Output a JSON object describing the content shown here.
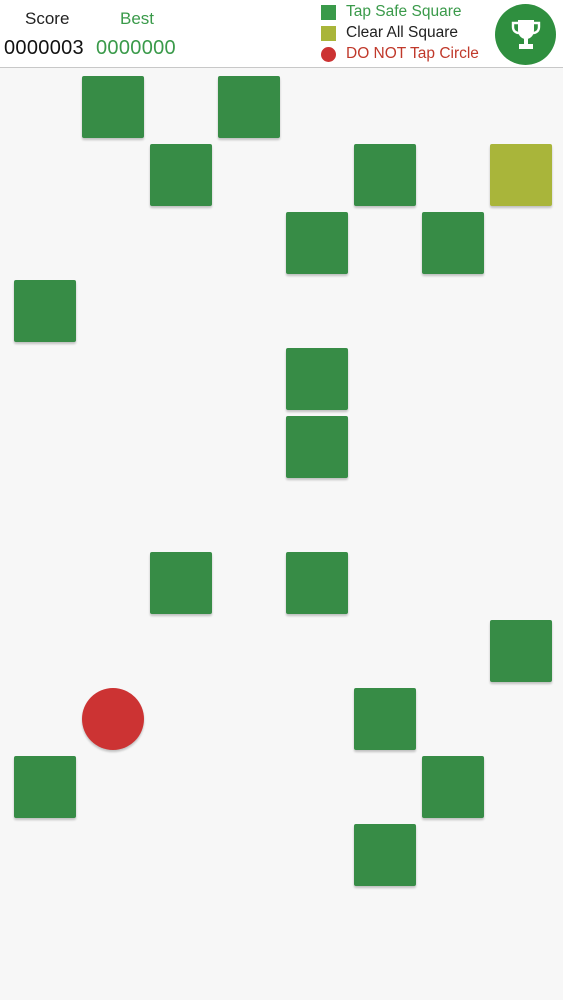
{
  "header": {
    "score_label": "Score",
    "best_label": "Best",
    "score_value": "0000003",
    "best_value": "0000000",
    "trophy_icon": "trophy-icon"
  },
  "legend": [
    {
      "kind": "square",
      "label": "Tap Safe Square",
      "color": "#3a9a4a",
      "text_color": "#3a9a4a"
    },
    {
      "kind": "square",
      "label": "Clear All Square",
      "color": "#a9b53a",
      "text_color": "#222222"
    },
    {
      "kind": "circle",
      "label": "DO NOT Tap Circle",
      "color": "#cc3333",
      "text_color": "#c0392b"
    }
  ],
  "colors": {
    "safe": "#378c46",
    "clear": "#a9b53a",
    "danger": "#cc3333",
    "accent": "#2f8f3f"
  },
  "board": {
    "columns": 8,
    "rows": 12,
    "pieces": [
      {
        "type": "safe",
        "col": 1,
        "row": 0
      },
      {
        "type": "safe",
        "col": 3,
        "row": 0
      },
      {
        "type": "safe",
        "col": 2,
        "row": 1
      },
      {
        "type": "safe",
        "col": 5,
        "row": 1
      },
      {
        "type": "clear",
        "col": 7,
        "row": 1
      },
      {
        "type": "safe",
        "col": 4,
        "row": 2
      },
      {
        "type": "safe",
        "col": 6,
        "row": 2
      },
      {
        "type": "safe",
        "col": 0,
        "row": 3
      },
      {
        "type": "safe",
        "col": 4,
        "row": 4
      },
      {
        "type": "safe",
        "col": 4,
        "row": 5
      },
      {
        "type": "safe",
        "col": 2,
        "row": 7
      },
      {
        "type": "safe",
        "col": 4,
        "row": 7
      },
      {
        "type": "safe",
        "col": 7,
        "row": 8
      },
      {
        "type": "danger",
        "col": 1,
        "row": 9
      },
      {
        "type": "safe",
        "col": 5,
        "row": 9
      },
      {
        "type": "safe",
        "col": 0,
        "row": 10
      },
      {
        "type": "safe",
        "col": 6,
        "row": 10
      },
      {
        "type": "safe",
        "col": 5,
        "row": 11
      }
    ]
  }
}
